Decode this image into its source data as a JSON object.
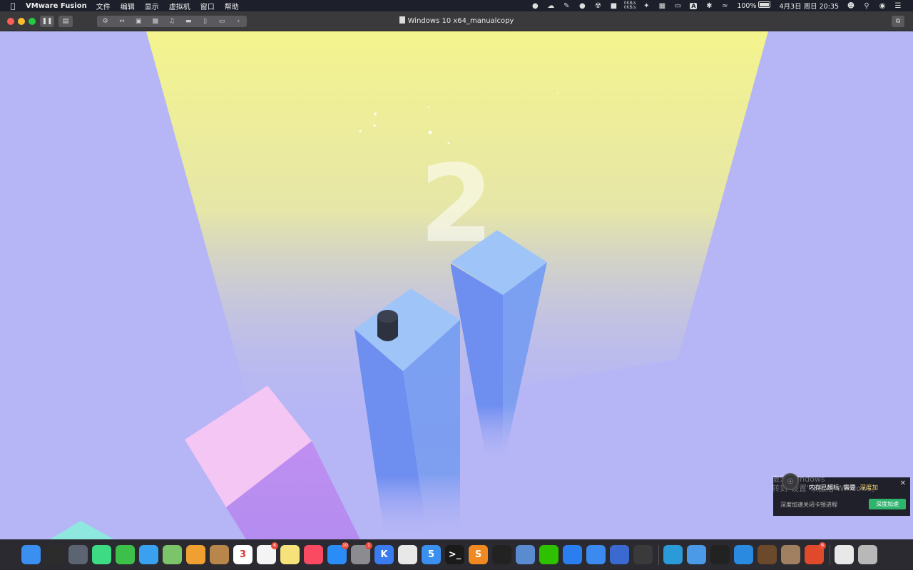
{
  "menubar": {
    "apple_icon": "apple-icon",
    "app_name": "VMware Fusion",
    "menus": [
      "文件",
      "编辑",
      "显示",
      "虚拟机",
      "窗口",
      "帮助"
    ],
    "net_up": "0KB/s",
    "net_down": "0KB/s",
    "input_method": "A",
    "battery": "100%",
    "datetime": "4月3日 周日  20:35"
  },
  "window": {
    "title": "Windows 10 x64_manualcopy"
  },
  "game": {
    "score": "2",
    "colors": {
      "background": "#b6b6f6",
      "spotlight": "#f4f48e",
      "pillar_top": "#9ec4f8",
      "pillar_side": "#6e8ef0",
      "pink_top": "#f4c6f4",
      "pink_side": "#c28ef0",
      "player": "#2d3140"
    }
  },
  "notification": {
    "watermark_line1": "激活 Windows",
    "watermark_line2": "转到\"设置\"以激活 Windows。",
    "text1": "内存已超标",
    "text2": "需要",
    "text_highlight": "深度加",
    "body": "深度加速关闭卡顿进程",
    "button": "深度加速"
  },
  "dock": {
    "apps": [
      {
        "name": "finder-icon",
        "color": "#3b8ff0",
        "label": ""
      },
      {
        "name": "activity-monitor-icon",
        "color": "#2c2c2c",
        "label": ""
      },
      {
        "name": "launchpad-icon",
        "color": "#5b6470",
        "label": ""
      },
      {
        "name": "android-studio-icon",
        "color": "#3ddc84",
        "label": ""
      },
      {
        "name": "facetime-icon",
        "color": "#3cc04a",
        "label": ""
      },
      {
        "name": "messages-icon",
        "color": "#3aa0f0",
        "label": ""
      },
      {
        "name": "maps-icon",
        "color": "#7cc46a",
        "label": ""
      },
      {
        "name": "photos-icon",
        "color": "#f0a030",
        "label": ""
      },
      {
        "name": "notes-book-icon",
        "color": "#b8864a",
        "label": ""
      },
      {
        "name": "calendar-icon",
        "color": "#ffffff",
        "label": "3"
      },
      {
        "name": "reminders-icon",
        "color": "#f4f4f4",
        "label": "",
        "badge": "6"
      },
      {
        "name": "notes-icon",
        "color": "#f6e27a",
        "label": ""
      },
      {
        "name": "music-icon",
        "color": "#fa4a62",
        "label": ""
      },
      {
        "name": "app-store-icon",
        "color": "#2a8cf6",
        "label": "",
        "badge": "10"
      },
      {
        "name": "system-preferences-icon",
        "color": "#8c8c90",
        "label": "",
        "badge": "1"
      },
      {
        "name": "keynote-k-icon",
        "color": "#3a7cf0",
        "label": "K"
      },
      {
        "name": "chrome-icon",
        "color": "#e8e8e8",
        "label": ""
      },
      {
        "name": "app-5-icon",
        "color": "#3a90f0",
        "label": "5"
      },
      {
        "name": "terminal-icon",
        "color": "#1a1a1a",
        "label": ">_"
      },
      {
        "name": "sublime-icon",
        "color": "#f08a20",
        "label": "S"
      },
      {
        "name": "qq-icon",
        "color": "#222222",
        "label": ""
      },
      {
        "name": "preview-icon",
        "color": "#5a8ad0",
        "label": ""
      },
      {
        "name": "wechat-icon",
        "color": "#2dc100",
        "label": ""
      },
      {
        "name": "xcode-icon",
        "color": "#2a7ef0",
        "label": ""
      },
      {
        "name": "pen-app-icon",
        "color": "#3a8af0",
        "label": ""
      },
      {
        "name": "vmware-icon",
        "color": "#3a6ad0",
        "label": ""
      },
      {
        "name": "unity-icon",
        "color": "#3a3a3a",
        "label": ""
      },
      {
        "name": "edge-icon",
        "color": "#2a9ad8",
        "label": ""
      },
      {
        "name": "browser-icon",
        "color": "#4a9ae8",
        "label": ""
      },
      {
        "name": "unity-hub-icon",
        "color": "#222222",
        "label": ""
      },
      {
        "name": "docker-icon",
        "color": "#2a8ae0",
        "label": ""
      },
      {
        "name": "alfred-icon",
        "color": "#6a4a2a",
        "label": ""
      },
      {
        "name": "archive-icon",
        "color": "#a08060",
        "label": ""
      },
      {
        "name": "office-icon",
        "color": "#e04a2a",
        "label": "",
        "badge": "6"
      },
      {
        "name": "zip-file-icon",
        "color": "#e8e8e8",
        "label": ""
      },
      {
        "name": "trash-icon",
        "color": "#b8b8b8",
        "label": ""
      }
    ]
  }
}
